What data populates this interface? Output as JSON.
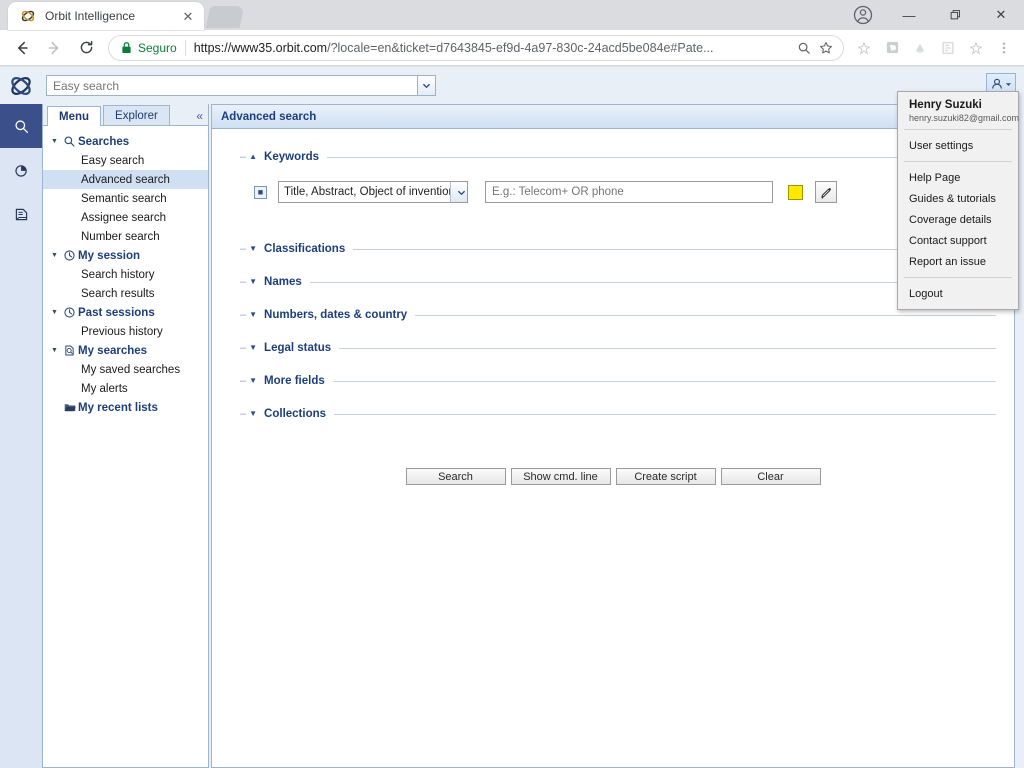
{
  "browser": {
    "tab": {
      "title": "Orbit Intelligence",
      "favicon_icon": "orbit-logo-icon",
      "close_icon": "close-icon"
    },
    "newtab_icon": "new-tab-icon",
    "window_controls": {
      "minimize": "—",
      "maximize": "❐",
      "close": "✕"
    },
    "profile_icon": "profile-avatar-icon",
    "nav": {
      "back_icon": "back-arrow-icon",
      "forward_icon": "forward-arrow-icon",
      "reload_icon": "reload-icon"
    },
    "omnibox": {
      "lock_icon": "lock-icon",
      "secure_label": "Seguro",
      "url_host": "https://www35.orbit.com",
      "url_path": "/?locale=en&ticket=d7643845-ef9d-4a97-830c-24acd5be084e#Pate...",
      "zoom_icon": "search-zoom-icon",
      "star_icon": "bookmark-star-icon"
    },
    "extensions": [
      "star-extension-icon",
      "pocket-icon",
      "drive-icon",
      "pdf-icon",
      "star2-icon",
      "menu-dots-icon"
    ]
  },
  "app": {
    "logo_icon": "orbit-logo-icon",
    "easy_search": {
      "value": "",
      "placeholder": "Easy search",
      "caret_icon": "chevron-down-icon"
    },
    "user_chip": {
      "avatar_icon": "user-avatar-icon",
      "caret_icon": "chevron-down-icon"
    },
    "rail": [
      {
        "icon": "search-icon",
        "active": true
      },
      {
        "icon": "pie-chart-icon",
        "active": false
      },
      {
        "icon": "document-icon",
        "active": false
      }
    ]
  },
  "sidebar": {
    "tabs": [
      {
        "label": "Menu",
        "active": true
      },
      {
        "label": "Explorer",
        "active": false
      }
    ],
    "collapse_icon": "collapse-left-icon",
    "groups": [
      {
        "label": "Searches",
        "icon": "magnifier-icon",
        "items": [
          {
            "label": "Easy search",
            "selected": false
          },
          {
            "label": "Advanced search",
            "selected": true
          },
          {
            "label": "Semantic search",
            "selected": false
          },
          {
            "label": "Assignee search",
            "selected": false
          },
          {
            "label": "Number search",
            "selected": false
          }
        ]
      },
      {
        "label": "My session",
        "icon": "clock-icon",
        "items": [
          {
            "label": "Search history",
            "selected": false
          },
          {
            "label": "Search results",
            "selected": false
          }
        ]
      },
      {
        "label": "Past sessions",
        "icon": "clock-icon",
        "items": [
          {
            "label": "Previous history",
            "selected": false
          }
        ]
      },
      {
        "label": "My searches",
        "icon": "saved-search-icon",
        "items": [
          {
            "label": "My saved searches",
            "selected": false
          },
          {
            "label": "My alerts",
            "selected": false
          }
        ]
      },
      {
        "label": "My recent lists",
        "icon": "folder-icon",
        "no_twisty": true,
        "items": []
      }
    ]
  },
  "content": {
    "header_title": "Advanced search",
    "sections": [
      {
        "label": "Keywords",
        "expanded": true
      },
      {
        "label": "Classifications",
        "expanded": false
      },
      {
        "label": "Names",
        "expanded": false
      },
      {
        "label": "Numbers, dates & country",
        "expanded": false
      },
      {
        "label": "Legal status",
        "expanded": false
      },
      {
        "label": "More fields",
        "expanded": false
      },
      {
        "label": "Collections",
        "expanded": false
      }
    ],
    "keywords_row": {
      "expand_icon": "expand-plus-icon",
      "field_select_value": "Title, Abstract, Object of invention, A",
      "field_select_caret": "chevron-down-icon",
      "query_value": "",
      "query_placeholder": "E.g.: Telecom+ OR phone",
      "highlight_color": "#ffe800",
      "highlight_swatch_name": "highlight-color-swatch",
      "tool_icon": "pencil-wand-icon"
    },
    "buttons": [
      {
        "label": "Search"
      },
      {
        "label": "Show cmd. line"
      },
      {
        "label": "Create script"
      },
      {
        "label": "Clear"
      }
    ]
  },
  "user_menu": {
    "name": "Henry Suzuki",
    "email": "henry.suzuki82@gmail.com",
    "items": [
      {
        "label": "User settings",
        "group": 1
      },
      {
        "label": "Help Page",
        "group": 2
      },
      {
        "label": "Guides & tutorials",
        "group": 2
      },
      {
        "label": "Coverage details",
        "group": 2
      },
      {
        "label": "Contact support",
        "group": 2
      },
      {
        "label": "Report an issue",
        "group": 2
      },
      {
        "label": "Logout",
        "group": 3
      }
    ]
  }
}
